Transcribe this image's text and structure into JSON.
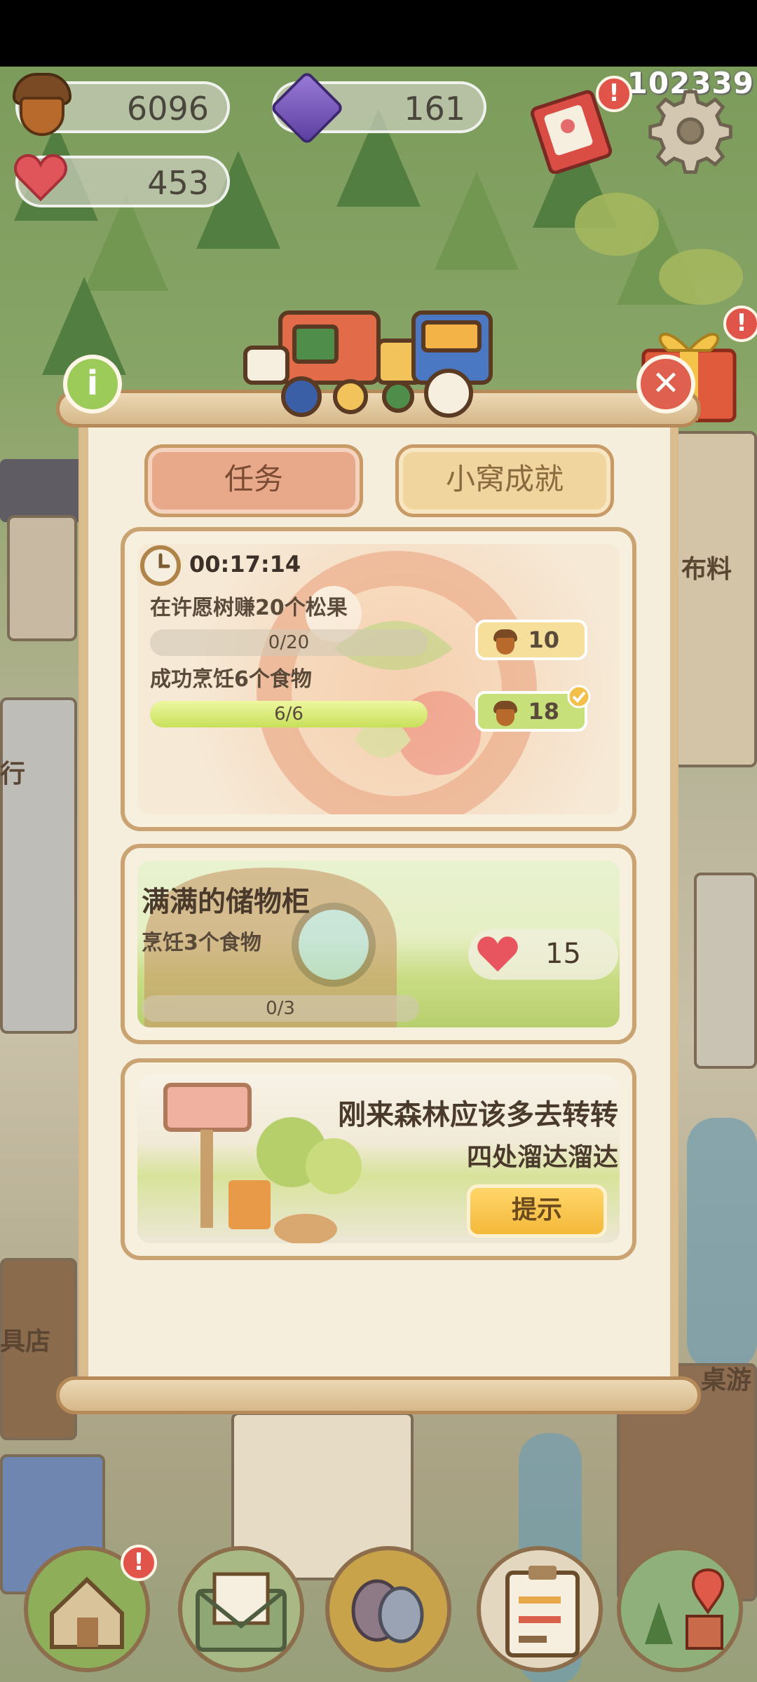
{
  "hud": {
    "acorns": "6096",
    "gems": "161",
    "hearts": "453",
    "coordinate_text": "102339"
  },
  "panel": {
    "tabs": [
      {
        "label": "任务",
        "active": true
      },
      {
        "label": "小窝成就",
        "active": false
      }
    ]
  },
  "task_card": {
    "timer": "00:17:14",
    "tasks": [
      {
        "title": "在许愿树赚20个松果",
        "progress_text": "0/20",
        "progress": 0.0,
        "reward": "10",
        "reward_type": "acorn",
        "completed": false
      },
      {
        "title": "成功烹饪6个食物",
        "progress_text": "6/6",
        "progress": 1.0,
        "reward": "18",
        "reward_type": "acorn",
        "completed": true
      }
    ]
  },
  "storage_card": {
    "title": "满满的储物柜",
    "task": "烹饪3个食物",
    "progress_text": "0/3",
    "progress": 0.0,
    "reward": "15",
    "reward_type": "heart"
  },
  "explore_card": {
    "line1": "刚来森林应该多去转转",
    "line2": "四处溜达溜达",
    "hint_label": "提示"
  },
  "background_labels": {
    "fabric_shop": "布料",
    "bank": "行",
    "shop_left": "具店",
    "shop_right": "桌游"
  },
  "colors": {
    "accent": "#e7a98a",
    "panel_bg": "#f6eedd",
    "progress_fill": "#c8e05a",
    "badge_red": "#e0544a",
    "hint_yellow": "#f4b93a"
  }
}
